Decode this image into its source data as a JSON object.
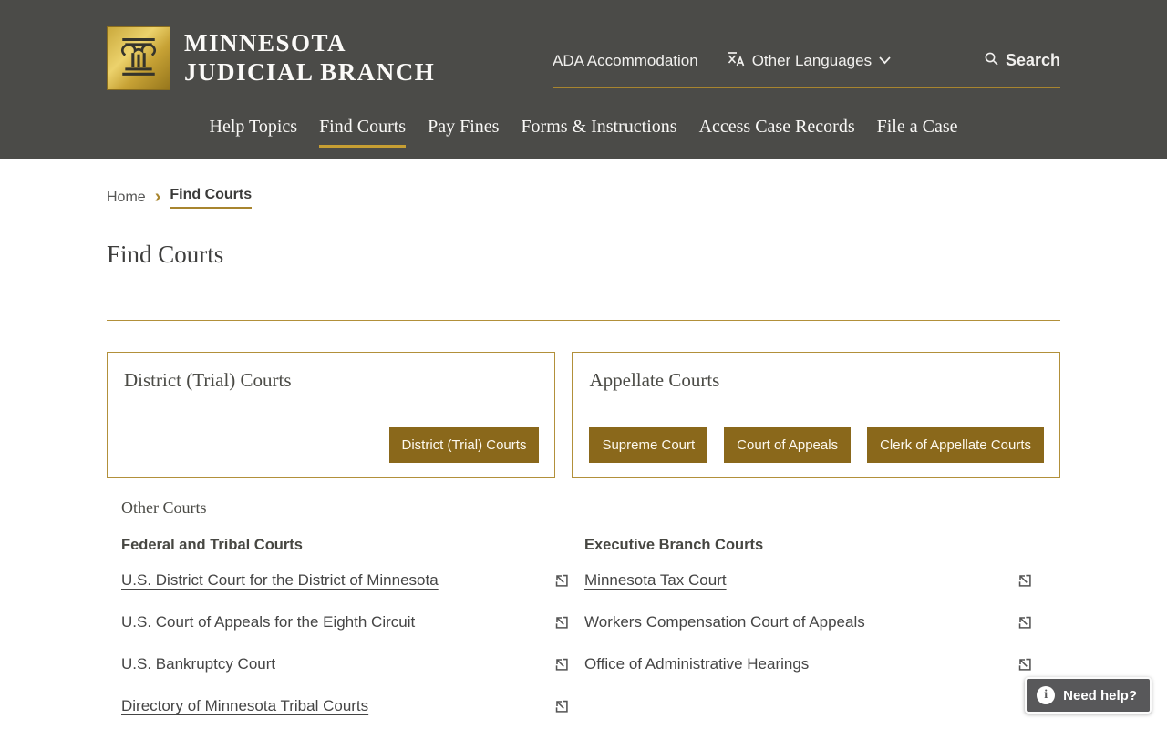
{
  "header": {
    "brand": {
      "line1": "MINNESOTA",
      "line2": "JUDICIAL BRANCH",
      "logo_icon": "column-pillar-icon"
    },
    "utility_nav": {
      "ada_label": "ADA Accommodation",
      "languages_label": "Other Languages",
      "languages_icon": "translate-icon",
      "languages_chevron": "chevron-down-icon",
      "search_label": "Search",
      "search_icon": "search-icon"
    },
    "main_nav": [
      {
        "label": "Help Topics",
        "active": false
      },
      {
        "label": "Find Courts",
        "active": true
      },
      {
        "label": "Pay Fines",
        "active": false
      },
      {
        "label": "Forms & Instructions",
        "active": false
      },
      {
        "label": "Access Case Records",
        "active": false
      },
      {
        "label": "File a Case",
        "active": false
      }
    ]
  },
  "breadcrumb": {
    "home": "Home",
    "separator": "›",
    "current": "Find Courts"
  },
  "page": {
    "title": "Find Courts"
  },
  "cards": [
    {
      "title": "District (Trial) Courts",
      "buttons": [
        "District (Trial) Courts"
      ]
    },
    {
      "title": "Appellate Courts",
      "buttons": [
        "Supreme Court",
        "Court of Appeals",
        "Clerk of Appellate Courts"
      ]
    }
  ],
  "other_courts": {
    "title": "Other Courts",
    "columns": [
      {
        "heading": "Federal and Tribal Courts",
        "links": [
          "U.S. District Court for the District of Minnesota",
          "U.S. Court of Appeals for the Eighth Circuit",
          "U.S. Bankruptcy Court",
          "Directory of Minnesota Tribal Courts"
        ]
      },
      {
        "heading": "Executive Branch Courts",
        "links": [
          "Minnesota Tax Court",
          "Workers Compensation Court of Appeals",
          "Office of Administrative Hearings"
        ]
      }
    ],
    "link_icon": "external-link-icon"
  },
  "help_button": {
    "label": "Need help?",
    "icon": "info-icon"
  },
  "colors": {
    "header_bg": "#4b4b48",
    "gold_accent": "#a8852f",
    "gold_border": "#b2903a",
    "button_bg": "#8a681b",
    "link_text": "#454545",
    "help_bg": "#58585a"
  }
}
